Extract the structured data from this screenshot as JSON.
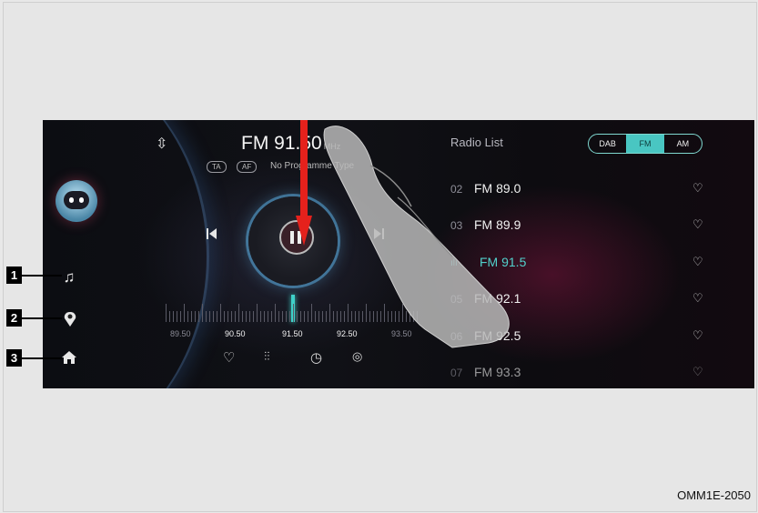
{
  "player": {
    "station_title": "FM 91.50",
    "title_unit": "MHz",
    "tags": [
      "TA",
      "AF"
    ],
    "program_type": "No Programme Type",
    "scale_labels": [
      "89.50",
      "90.50",
      "91.50",
      "92.50",
      "93.50"
    ]
  },
  "list": {
    "title": "Radio List",
    "bands": [
      "DAB",
      "FM",
      "AM"
    ],
    "active_band": "FM",
    "stations": [
      {
        "num": "02",
        "name": "FM 89.0"
      },
      {
        "num": "03",
        "name": "FM 89.9"
      },
      {
        "num": "",
        "name": "FM 91.5",
        "playing": true
      },
      {
        "num": "05",
        "name": "FM 92.1"
      },
      {
        "num": "06",
        "name": "FM 92.5"
      },
      {
        "num": "07",
        "name": "FM 93.3"
      }
    ]
  },
  "sidebar": {
    "icons": [
      "robot-avatar-icon",
      "music-note-icon",
      "location-pin-icon",
      "home-icon"
    ]
  },
  "callouts": [
    "1",
    "2",
    "3"
  ],
  "figure_code": "OMM1E-2050",
  "colors": {
    "accent": "#49c6c2",
    "arrow": "#e5211c"
  }
}
